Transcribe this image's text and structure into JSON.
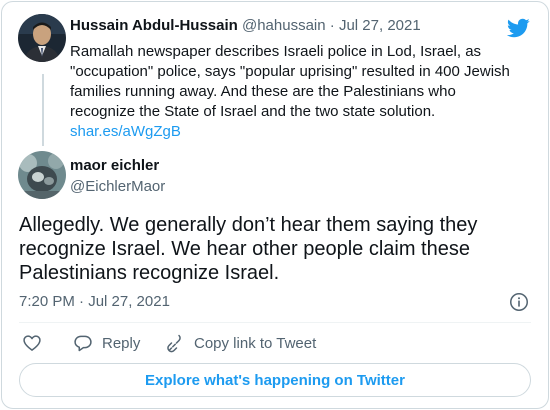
{
  "quoted_tweet": {
    "author_name": "Hussain Abdul-Hussain",
    "author_handle": "@hahussain",
    "separator": "·",
    "date": "Jul 27, 2021",
    "text": "Ramallah newspaper describes Israeli police in Lod, Israel, as \"occupation\" police, says \"popular uprising\" resulted in 400 Jewish families running away. And these are the Palestinians who recognize the State of Israel and the two state solution.",
    "link": "shar.es/aWgZgB"
  },
  "tweet": {
    "author_name": "maor eichler",
    "author_handle": "@EichlerMaor",
    "text": "Allegedly. We generally don’t hear them saying they recognize Israel. We hear other people claim these Palestinians recognize Israel.",
    "timestamp": "7:20 PM · Jul 27, 2021"
  },
  "actions": {
    "like_icon": "heart-icon",
    "reply_label": "Reply",
    "copy_link_label": "Copy link to Tweet"
  },
  "explore_label": "Explore what's happening on Twitter",
  "colors": {
    "accent": "#1d9bf0",
    "text": "#0f1419",
    "muted": "#536471",
    "border": "#cfd9de"
  }
}
